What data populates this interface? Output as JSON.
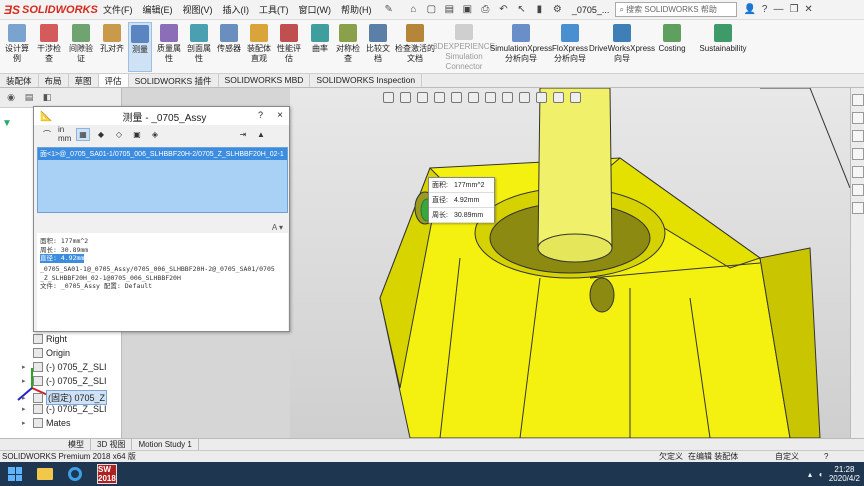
{
  "titlebar": {
    "app_name": "SOLIDWORKS",
    "menu": [
      "文件(F)",
      "编辑(E)",
      "视图(V)",
      "插入(I)",
      "工具(T)",
      "窗口(W)",
      "帮助(H)"
    ],
    "filename": "_0705_...",
    "search_placeholder": "搜索 SOLIDWORKS 帮助",
    "help_label": "?"
  },
  "ribbon": {
    "buttons": [
      {
        "label": "设计算例",
        "active": false
      },
      {
        "label": "干涉检查",
        "active": false
      },
      {
        "label": "间隙验证",
        "active": false
      },
      {
        "label": "孔对齐",
        "active": false
      },
      {
        "label": "测量",
        "active": true
      },
      {
        "label": "质量属性",
        "active": false
      },
      {
        "label": "剖面属性",
        "active": false
      },
      {
        "label": "传感器",
        "active": false
      },
      {
        "label": "装配体直观",
        "active": false
      },
      {
        "label": "性能评估",
        "active": false
      },
      {
        "label": "曲率",
        "active": false
      },
      {
        "label": "对称检查",
        "active": false
      },
      {
        "label": "比较文档",
        "active": false
      },
      {
        "label": "检查激活的文档",
        "active": false
      },
      {
        "label": "3DEXPERIENCE Simulation Connector",
        "active": false,
        "disabled": true
      },
      {
        "label": "SimulationXpress 分析向导",
        "active": false
      },
      {
        "label": "FloXpress 分析向导",
        "active": false
      },
      {
        "label": "DriveWorksXpress 向导",
        "active": false
      },
      {
        "label": "Costing",
        "active": false
      },
      {
        "label": "Sustainability",
        "active": false
      }
    ]
  },
  "command_tabs": [
    "装配体",
    "布局",
    "草图",
    "评估",
    "SOLIDWORKS 插件",
    "SOLIDWORKS MBD",
    "SOLIDWORKS Inspection"
  ],
  "command_tabs_active": "评估",
  "tree": {
    "items": [
      {
        "label": "Right",
        "expand": "",
        "selected": false
      },
      {
        "label": "Origin",
        "expand": "",
        "selected": false
      },
      {
        "label": "(-) 0705_Z_SLI",
        "expand": "▸",
        "selected": false
      },
      {
        "label": "(-) 0705_Z_SLI",
        "expand": "▸",
        "selected": false
      },
      {
        "label": "(固定) 0705_Z",
        "expand": "▸",
        "selected": true
      },
      {
        "label": "(-) 0705_Z_SLI",
        "expand": "▸",
        "selected": false
      },
      {
        "label": "Mates",
        "expand": "▸",
        "selected": false
      }
    ]
  },
  "measure": {
    "title": "测量 - _0705_Assy",
    "help": "?",
    "close": "×",
    "units_label": "in mm",
    "selection": "面<1>@_0705_SA01-1/0705_006_SLHBBF20H-2/0705_Z_SLHBBF20H_02-1",
    "results": [
      "面积: 177mm^2",
      "周长: 30.89mm",
      "直径: 4.92mm",
      "_0705_SA01-1@_0705_Assy/0705_006_SLHBBF20H-2@_0705_SA01/0705",
      "_Z_SLHBBF20H_02-1@0705_006_SLHBBF20H",
      "文件: _0705_Assy 配置: Default"
    ]
  },
  "tooltip": {
    "rows": [
      {
        "key": "面积:",
        "value": "177mm^2"
      },
      {
        "key": "直径:",
        "value": "4.92mm"
      },
      {
        "key": "周长:",
        "value": "30.89mm"
      }
    ]
  },
  "bottom_tabs": [
    "模型",
    "3D 视图",
    "Motion Study 1"
  ],
  "bottom_tabs_active": "模型",
  "status": {
    "version": "SOLIDWORKS Premium 2018 x64 版",
    "underdefined": "欠定义",
    "editing": "在编辑 装配体",
    "custom": "自定义",
    "help": "?"
  },
  "taskbar": {
    "time": "21:28",
    "date": "2020/4/2",
    "sw_label": "SW 2018"
  },
  "colors": {
    "part_yellow": "#f4f010",
    "shaft_yellow": "#f0f06a",
    "selection_blue": "#3c8de0",
    "brand_red": "#d52b1e"
  }
}
